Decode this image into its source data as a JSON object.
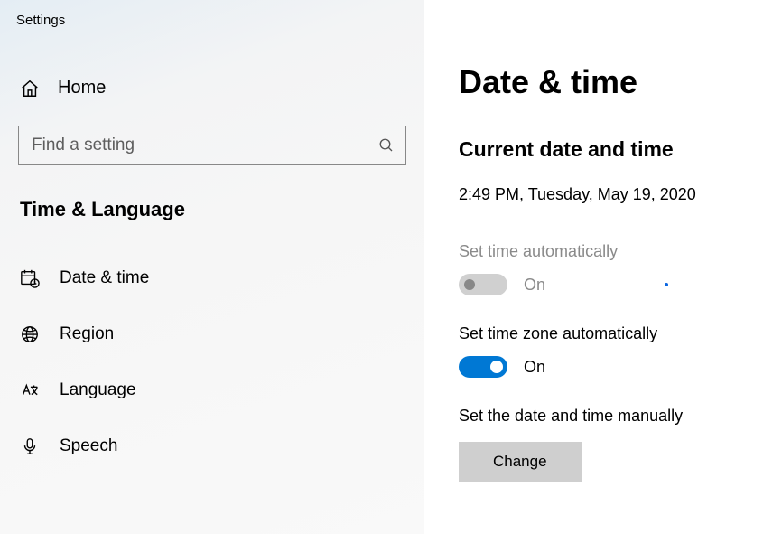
{
  "appTitle": "Settings",
  "sidebar": {
    "home": "Home",
    "searchPlaceholder": "Find a setting",
    "category": "Time & Language",
    "items": [
      {
        "label": "Date & time"
      },
      {
        "label": "Region"
      },
      {
        "label": "Language"
      },
      {
        "label": "Speech"
      }
    ]
  },
  "main": {
    "pageTitle": "Date & time",
    "currentSection": "Current date and time",
    "currentValue": "2:49 PM, Tuesday, May 19, 2020",
    "setTimeAuto": {
      "label": "Set time automatically",
      "state": "On",
      "enabled": false,
      "value": false
    },
    "setZoneAuto": {
      "label": "Set time zone automatically",
      "state": "On",
      "enabled": true,
      "value": true
    },
    "manual": {
      "label": "Set the date and time manually",
      "button": "Change"
    }
  }
}
